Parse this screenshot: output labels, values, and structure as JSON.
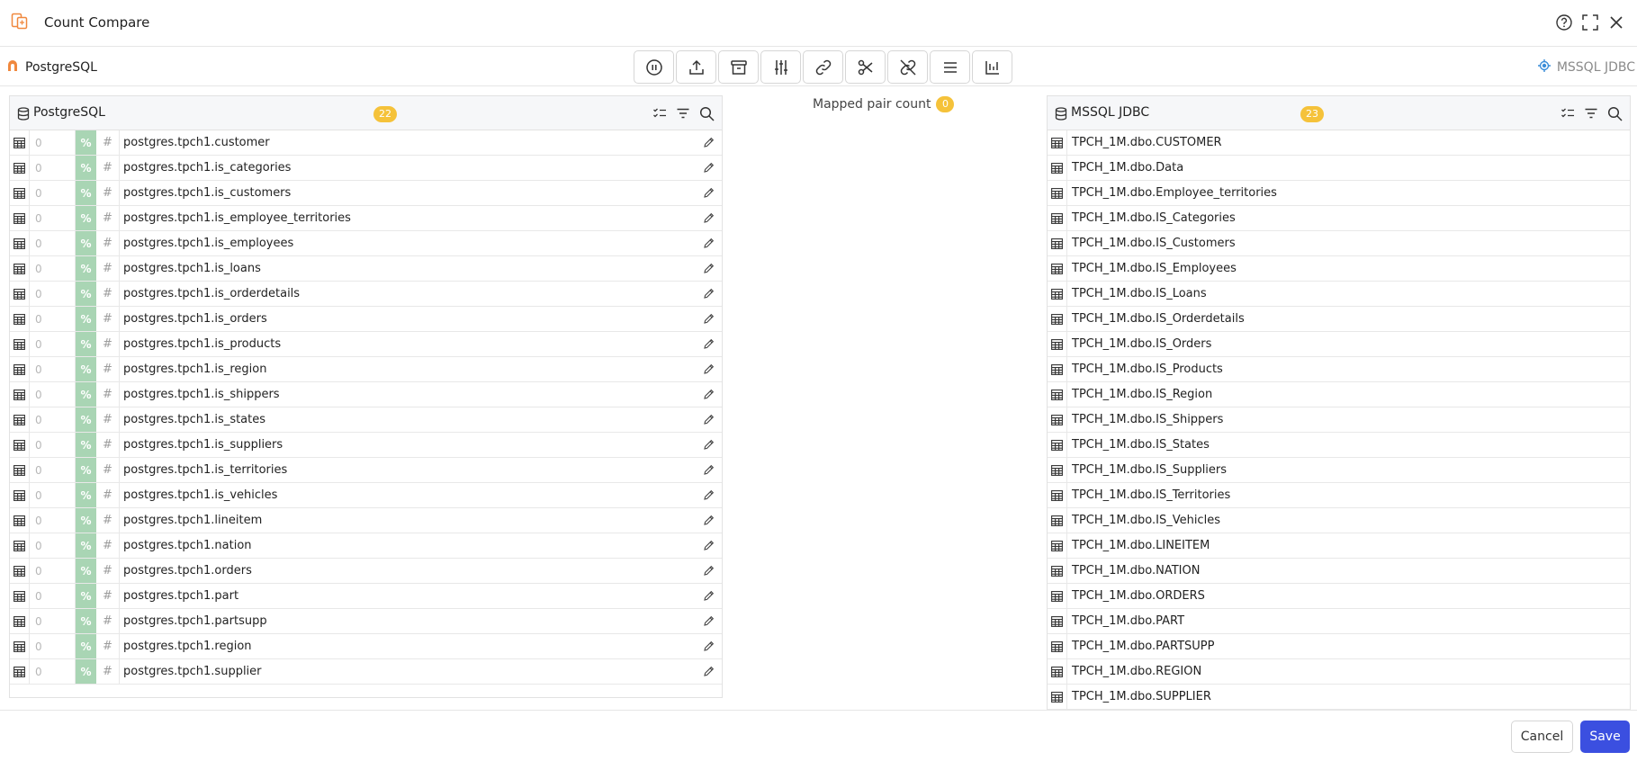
{
  "window": {
    "title": "Count Compare"
  },
  "source_bar": {
    "source_label": "PostgreSQL",
    "target_label": "MSSQL JDBC"
  },
  "toolbar": {
    "icons": [
      "pause-icon",
      "upload-icon",
      "archive-icon",
      "sliders-icon",
      "link-icon",
      "scissors-icon",
      "unlink-icon",
      "list-icon",
      "align-bottom-icon"
    ]
  },
  "left_panel": {
    "title": "PostgreSQL",
    "count": "22",
    "rows": [
      {
        "count": "0",
        "pct": "%",
        "hash": "#",
        "name": "postgres.tpch1.customer"
      },
      {
        "count": "0",
        "pct": "%",
        "hash": "#",
        "name": "postgres.tpch1.is_categories"
      },
      {
        "count": "0",
        "pct": "%",
        "hash": "#",
        "name": "postgres.tpch1.is_customers"
      },
      {
        "count": "0",
        "pct": "%",
        "hash": "#",
        "name": "postgres.tpch1.is_employee_territories"
      },
      {
        "count": "0",
        "pct": "%",
        "hash": "#",
        "name": "postgres.tpch1.is_employees"
      },
      {
        "count": "0",
        "pct": "%",
        "hash": "#",
        "name": "postgres.tpch1.is_loans"
      },
      {
        "count": "0",
        "pct": "%",
        "hash": "#",
        "name": "postgres.tpch1.is_orderdetails"
      },
      {
        "count": "0",
        "pct": "%",
        "hash": "#",
        "name": "postgres.tpch1.is_orders"
      },
      {
        "count": "0",
        "pct": "%",
        "hash": "#",
        "name": "postgres.tpch1.is_products"
      },
      {
        "count": "0",
        "pct": "%",
        "hash": "#",
        "name": "postgres.tpch1.is_region"
      },
      {
        "count": "0",
        "pct": "%",
        "hash": "#",
        "name": "postgres.tpch1.is_shippers"
      },
      {
        "count": "0",
        "pct": "%",
        "hash": "#",
        "name": "postgres.tpch1.is_states"
      },
      {
        "count": "0",
        "pct": "%",
        "hash": "#",
        "name": "postgres.tpch1.is_suppliers"
      },
      {
        "count": "0",
        "pct": "%",
        "hash": "#",
        "name": "postgres.tpch1.is_territories"
      },
      {
        "count": "0",
        "pct": "%",
        "hash": "#",
        "name": "postgres.tpch1.is_vehicles"
      },
      {
        "count": "0",
        "pct": "%",
        "hash": "#",
        "name": "postgres.tpch1.lineitem"
      },
      {
        "count": "0",
        "pct": "%",
        "hash": "#",
        "name": "postgres.tpch1.nation"
      },
      {
        "count": "0",
        "pct": "%",
        "hash": "#",
        "name": "postgres.tpch1.orders"
      },
      {
        "count": "0",
        "pct": "%",
        "hash": "#",
        "name": "postgres.tpch1.part"
      },
      {
        "count": "0",
        "pct": "%",
        "hash": "#",
        "name": "postgres.tpch1.partsupp"
      },
      {
        "count": "0",
        "pct": "%",
        "hash": "#",
        "name": "postgres.tpch1.region"
      },
      {
        "count": "0",
        "pct": "%",
        "hash": "#",
        "name": "postgres.tpch1.supplier"
      }
    ]
  },
  "mapped": {
    "label": "Mapped pair count",
    "count": "0"
  },
  "right_panel": {
    "title": "MSSQL JDBC",
    "count": "23",
    "rows": [
      {
        "name": "TPCH_1M.dbo.CUSTOMER"
      },
      {
        "name": "TPCH_1M.dbo.Data"
      },
      {
        "name": "TPCH_1M.dbo.Employee_territories"
      },
      {
        "name": "TPCH_1M.dbo.IS_Categories"
      },
      {
        "name": "TPCH_1M.dbo.IS_Customers"
      },
      {
        "name": "TPCH_1M.dbo.IS_Employees"
      },
      {
        "name": "TPCH_1M.dbo.IS_Loans"
      },
      {
        "name": "TPCH_1M.dbo.IS_Orderdetails"
      },
      {
        "name": "TPCH_1M.dbo.IS_Orders"
      },
      {
        "name": "TPCH_1M.dbo.IS_Products"
      },
      {
        "name": "TPCH_1M.dbo.IS_Region"
      },
      {
        "name": "TPCH_1M.dbo.IS_Shippers"
      },
      {
        "name": "TPCH_1M.dbo.IS_States"
      },
      {
        "name": "TPCH_1M.dbo.IS_Suppliers"
      },
      {
        "name": "TPCH_1M.dbo.IS_Territories"
      },
      {
        "name": "TPCH_1M.dbo.IS_Vehicles"
      },
      {
        "name": "TPCH_1M.dbo.LINEITEM"
      },
      {
        "name": "TPCH_1M.dbo.NATION"
      },
      {
        "name": "TPCH_1M.dbo.ORDERS"
      },
      {
        "name": "TPCH_1M.dbo.PART"
      },
      {
        "name": "TPCH_1M.dbo.PARTSUPP"
      },
      {
        "name": "TPCH_1M.dbo.REGION"
      },
      {
        "name": "TPCH_1M.dbo.SUPPLIER"
      }
    ]
  },
  "footer": {
    "cancel_label": "Cancel",
    "save_label": "Save"
  },
  "colors": {
    "accent": "#3b4fe0",
    "badge": "#f5c23a",
    "pct_cell": "#a9d5b4",
    "app_icon": "#f0883e",
    "target_icon": "#3a8dd8"
  }
}
